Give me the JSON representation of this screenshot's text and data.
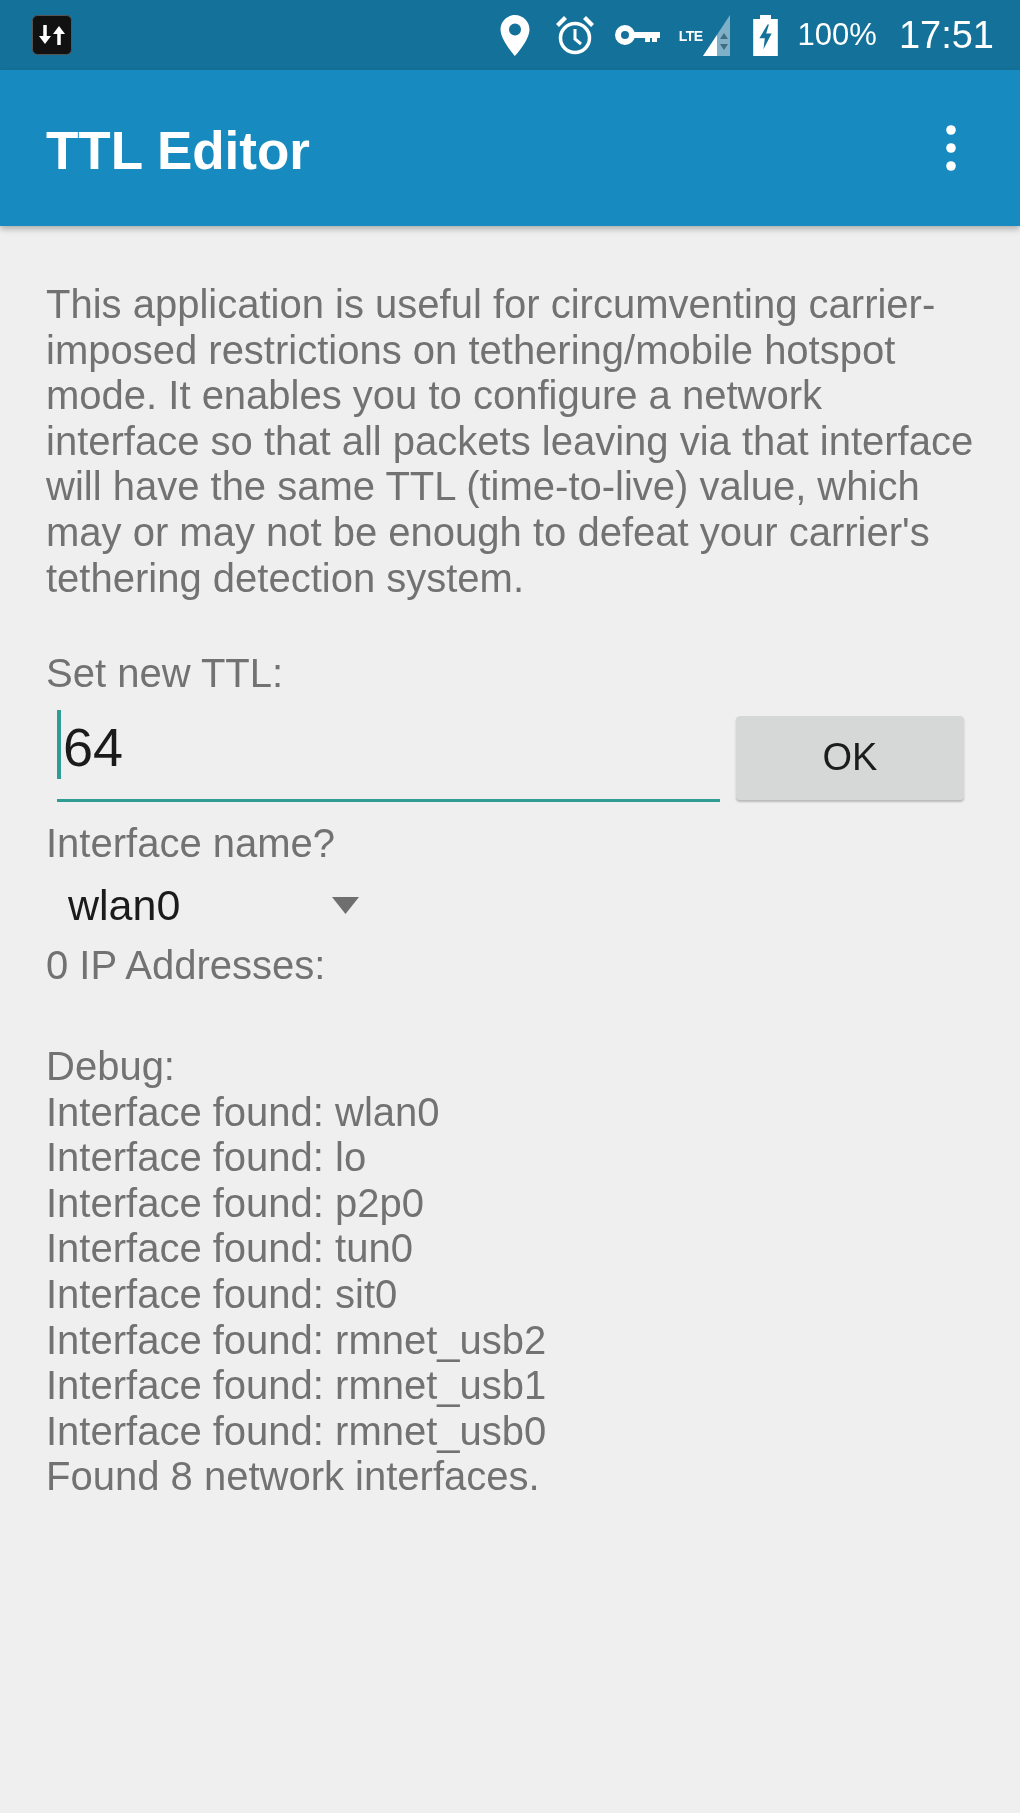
{
  "status_bar": {
    "network_type": "LTE",
    "battery": "100%",
    "time": "17:51"
  },
  "app_bar": {
    "title": "TTL Editor"
  },
  "description": "This application is useful for circumventing carrier-imposed restrictions on tethering/mobile hotspot mode. It enables you to configure a network interface so that all packets leaving via that interface will have the same TTL (time-to-live) value, which may or may not be enough to defeat your carrier's tethering detection system.",
  "ttl": {
    "label": "Set new TTL:",
    "value": "64",
    "focused": true,
    "button": "OK"
  },
  "interface": {
    "label": "Interface name?",
    "value": "wlan0"
  },
  "ip_addresses": "0 IP Addresses:",
  "debug": [
    "Debug:",
    "Interface found: wlan0",
    "Interface found: lo",
    "Interface found: p2p0",
    "Interface found: tun0",
    "Interface found: sit0",
    "Interface found: rmnet_usb2",
    "Interface found: rmnet_usb1",
    "Interface found: rmnet_usb0",
    "Found 8 network interfaces."
  ]
}
